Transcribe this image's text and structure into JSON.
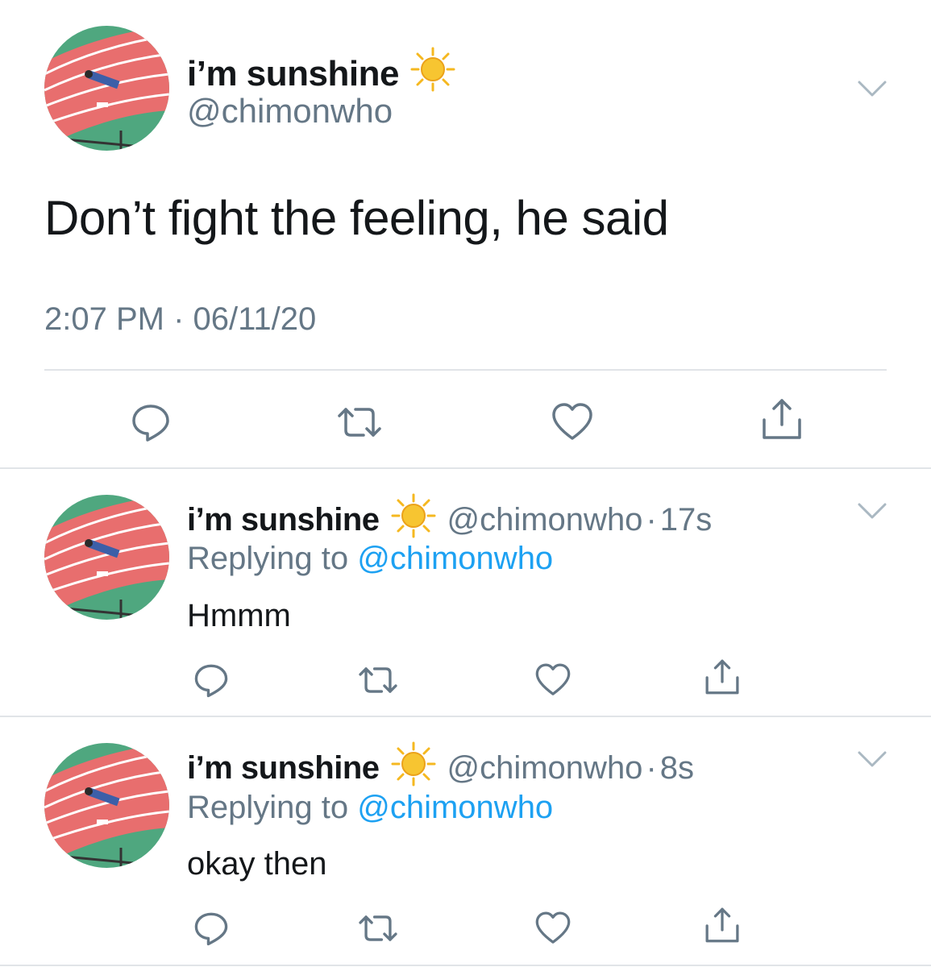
{
  "main_tweet": {
    "display_name": "i’m sunshine",
    "name_emoji": "sun-emoji",
    "handle": "@chimonwho",
    "text": "Don’t fight the feeling, he said",
    "timestamp": "2:07 PM · 06/11/20",
    "actions": [
      "reply-icon",
      "retweet-icon",
      "like-icon",
      "share-icon"
    ]
  },
  "replies": [
    {
      "display_name": "i’m sunshine",
      "name_emoji": "sun-emoji",
      "handle": "@chimonwho",
      "separator": "·",
      "age": "17s",
      "replying_prefix": "Replying to",
      "replying_handle": "@chimonwho",
      "text": "Hmmm"
    },
    {
      "display_name": "i’m sunshine",
      "name_emoji": "sun-emoji",
      "handle": "@chimonwho",
      "separator": "·",
      "age": "8s",
      "replying_prefix": "Replying to",
      "replying_handle": "@chimonwho",
      "text": "okay then"
    }
  ],
  "colors": {
    "text": "#14171a",
    "secondary": "#657786",
    "link": "#1da1f2",
    "divider": "#e1e4e8",
    "sun": "#f5b820"
  }
}
